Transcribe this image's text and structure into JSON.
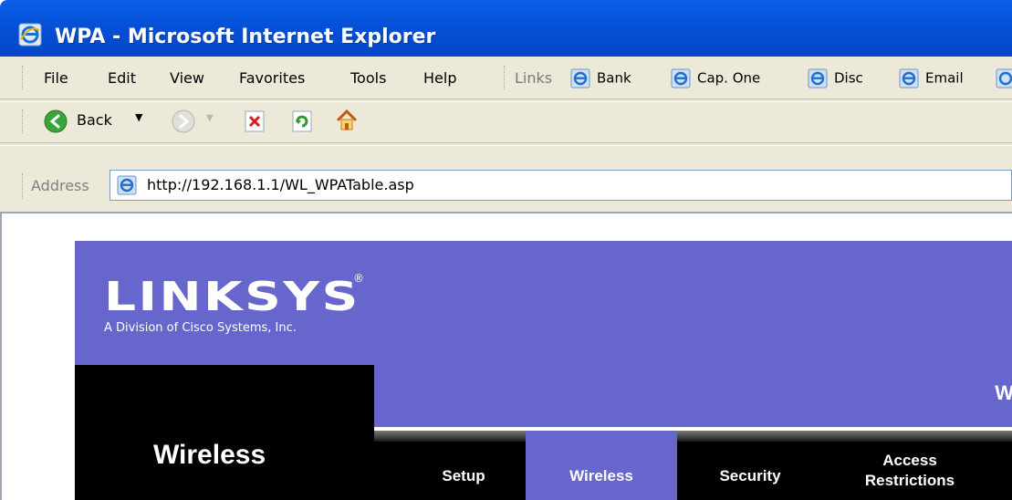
{
  "window": {
    "title": "WPA - Microsoft Internet Explorer"
  },
  "menu": [
    "File",
    "Edit",
    "View",
    "Favorites",
    "Tools",
    "Help"
  ],
  "links_bar": {
    "label": "Links",
    "items": [
      "Bank",
      "Cap. One",
      "Disc",
      "Email"
    ]
  },
  "toolbar": {
    "back_label": "Back"
  },
  "address": {
    "label": "Address",
    "url": "http://192.168.1.1/WL_WPATable.asp"
  },
  "page": {
    "logo": "LINKSYS",
    "logo_reg": "®",
    "logo_subtitle": "A Division of Cisco Systems, Inc.",
    "header_partial": "W",
    "section_title": "Wireless",
    "tabs": [
      "Setup",
      "Wireless",
      "Security",
      "Access Restrictions"
    ]
  },
  "colors": {
    "brand_purple": "#6666cc",
    "xp_titlebar": "#0550d8"
  }
}
